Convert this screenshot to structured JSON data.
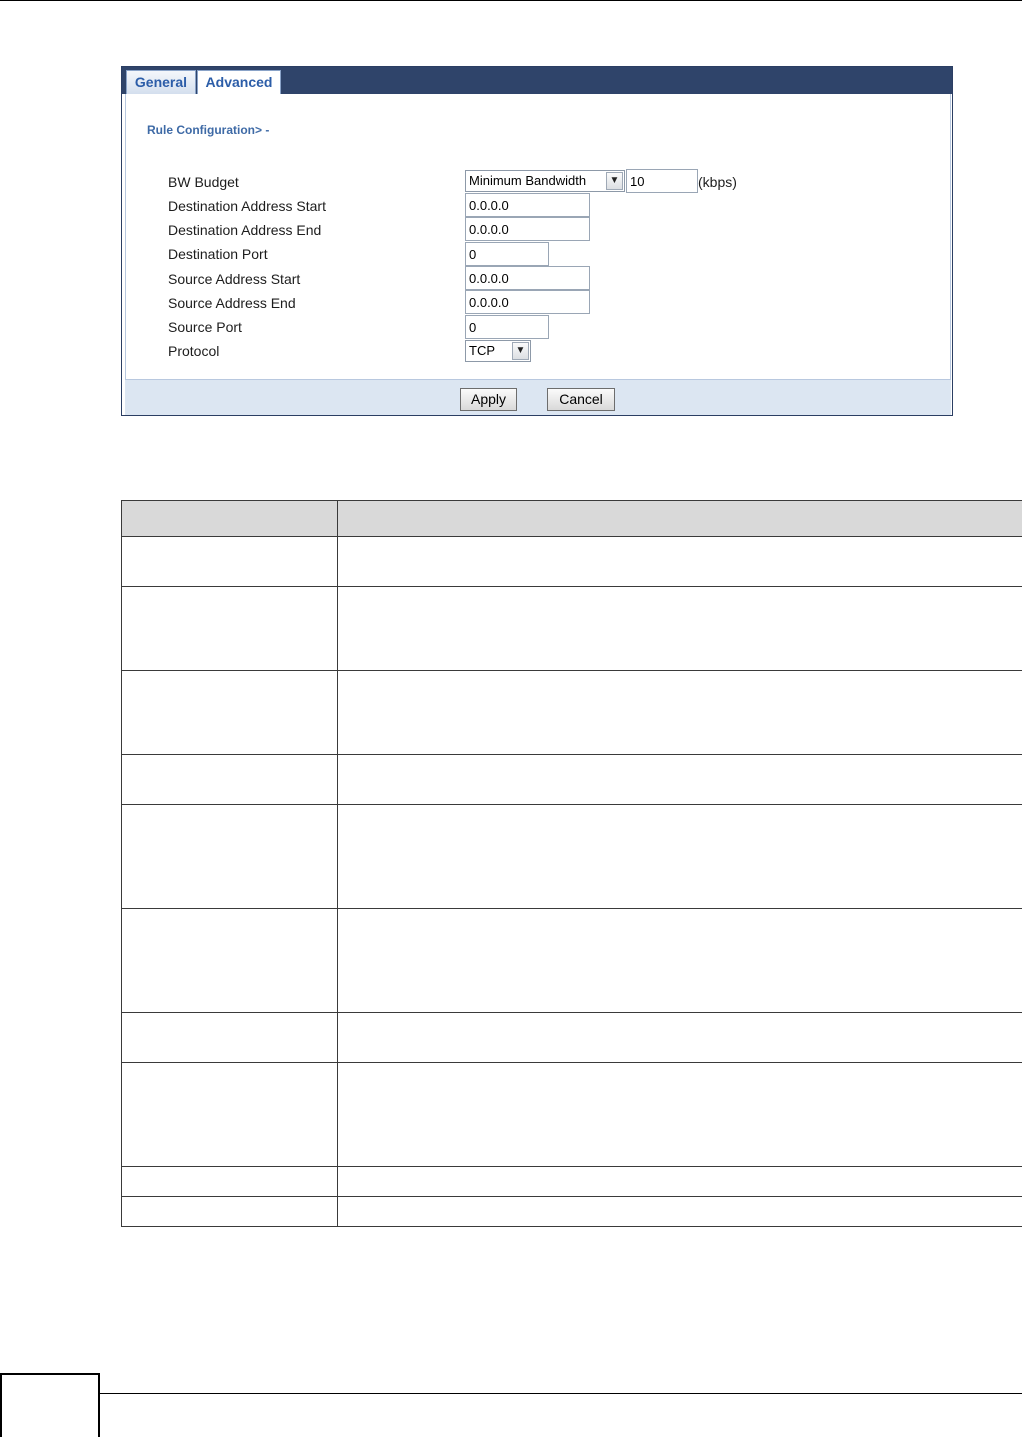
{
  "tabs": [
    {
      "label": "General"
    },
    {
      "label": "Advanced",
      "active": true
    }
  ],
  "section_title": "Rule Configuration> -",
  "form": {
    "bw_budget": {
      "label": "BW Budget",
      "mode": "Minimum Bandwidth",
      "value": "10",
      "unit": "(kbps)"
    },
    "dest_start": {
      "label": "Destination Address Start",
      "value": "0.0.0.0"
    },
    "dest_end": {
      "label": "Destination Address End",
      "value": "0.0.0.0"
    },
    "dest_port": {
      "label": "Destination Port",
      "value": "0"
    },
    "src_start": {
      "label": "Source Address Start",
      "value": "0.0.0.0"
    },
    "src_end": {
      "label": "Source Address End",
      "value": "0.0.0.0"
    },
    "src_port": {
      "label": "Source Port",
      "value": "0"
    },
    "protocol": {
      "label": "Protocol",
      "value": "TCP"
    }
  },
  "buttons": {
    "apply": "Apply",
    "cancel": "Cancel"
  },
  "icons": {
    "dropdown": "chevron-down-icon"
  },
  "colors": {
    "tab_bar": "#2f446a",
    "tab_text": "#2c5da8",
    "section_title": "#3e6aa6",
    "footer_bar": "#dce6f2",
    "table_header": "#d9d9d9"
  }
}
